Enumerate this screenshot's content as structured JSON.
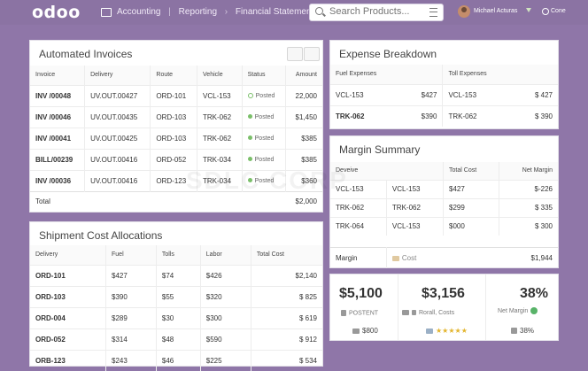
{
  "topbar": {
    "logo": "odoo",
    "breadcrumbs": [
      "Accounting",
      "Reporting",
      "Financial Statements"
    ],
    "search_placeholder": "Search Products...",
    "user": "Michael Acturas",
    "company": "Cone"
  },
  "invoices": {
    "title": "Automated Invoices",
    "columns": [
      "Invoice",
      "Delivery",
      "Route",
      "Vehicle",
      "Status",
      "Amount"
    ],
    "rows": [
      {
        "invoice": "INV /00048",
        "delivery": "UV.OUT.00427",
        "route": "ORD-101",
        "vehicle": "VCL-153",
        "status": "Posted",
        "amount": "22,000"
      },
      {
        "invoice": "INV /00046",
        "delivery": "UV.OUT.00435",
        "route": "ORD-103",
        "vehicle": "TRK-062",
        "status": "Posted",
        "amount": "$1,450"
      },
      {
        "invoice": "INV /00041",
        "delivery": "UV.OUT.00425",
        "route": "ORD-103",
        "vehicle": "TRK-062",
        "status": "Posted",
        "amount": "$385"
      },
      {
        "invoice": "BILL/00239",
        "delivery": "UV.OUT.00416",
        "route": "ORD-052",
        "vehicle": "TRK-034",
        "status": "Posted",
        "amount": "$385"
      },
      {
        "invoice": "INV /00036",
        "delivery": "UV.OUT.00416",
        "route": "ORD-123",
        "vehicle": "TRK-034",
        "status": "Posted",
        "amount": "$360"
      }
    ],
    "total_label": "Total",
    "total_value": "$2,000"
  },
  "shipment": {
    "title": "Shipment Cost Allocations",
    "columns": [
      "Delivery",
      "Fuel",
      "Tolls",
      "Labor",
      "Total Cost"
    ],
    "rows": [
      {
        "delivery": "ORD-101",
        "fuel": "$427",
        "tolls": "$74",
        "labor": "$426",
        "total": "$2,140"
      },
      {
        "delivery": "ORD-103",
        "fuel": "$390",
        "tolls": "$55",
        "labor": "$320",
        "total": "$ 825"
      },
      {
        "delivery": "ORD-004",
        "fuel": "$289",
        "tolls": "$30",
        "labor": "$300",
        "total": "$ 619"
      },
      {
        "delivery": "ORD-052",
        "fuel": "$314",
        "tolls": "$48",
        "labor": "$590",
        "total": "$ 912"
      },
      {
        "delivery": "ORB-123",
        "fuel": "$243",
        "tolls": "$46",
        "labor": "$225",
        "total": "$ 534"
      }
    ]
  },
  "expense": {
    "title": "Expense Breakdown",
    "fuel_label": "Fuel Expenses",
    "toll_label": "Toll Expenses",
    "rows": [
      {
        "v1": "VCL-153",
        "a1": "$427",
        "v2": "VCL-153",
        "a2": "$ 427"
      },
      {
        "v1": "TRK-062",
        "a1": "$390",
        "v2": "TRK-062",
        "a2": "$ 390"
      }
    ]
  },
  "margin": {
    "title": "Margin Summary",
    "columns": [
      "Deveive",
      "",
      "Total Cost",
      "Net Margin"
    ],
    "rows": [
      {
        "c1": "VCL-153",
        "c2": "VCL-153",
        "cost": "$427",
        "net": "$-226"
      },
      {
        "c1": "TRK-062",
        "c2": "TRK-062",
        "cost": "$299",
        "net": "$ 335"
      },
      {
        "c1": "TRK-064",
        "c2": "VCL-153",
        "cost": "$000",
        "net": "$ 300"
      }
    ],
    "footer_label": "Margin",
    "footer_cost": "Cost",
    "footer_value": "$1,944"
  },
  "kpis": [
    {
      "value": "$5,100",
      "label": "POSTENT",
      "foot": "$800"
    },
    {
      "value": "$3,156",
      "label": "Rorall, Costs",
      "foot": ""
    },
    {
      "value": "38%",
      "label": "Net Margin",
      "foot": "38%"
    }
  ],
  "watermark": "SDLC CORP",
  "colors": {
    "brand": "#8b73a3",
    "posted": "#7bbf6a",
    "stars": "#e3b52e"
  }
}
